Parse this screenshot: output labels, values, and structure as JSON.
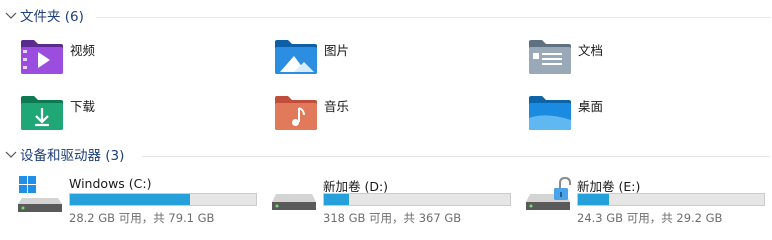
{
  "folders_section": {
    "title": "文件夹 (6)",
    "items": [
      {
        "label": "视频",
        "icon": "videos-folder-icon"
      },
      {
        "label": "图片",
        "icon": "pictures-folder-icon"
      },
      {
        "label": "文档",
        "icon": "documents-folder-icon"
      },
      {
        "label": "下载",
        "icon": "downloads-folder-icon"
      },
      {
        "label": "音乐",
        "icon": "music-folder-icon"
      },
      {
        "label": "桌面",
        "icon": "desktop-folder-icon"
      }
    ]
  },
  "drives_section": {
    "title": "设备和驱动器 (3)",
    "drives": [
      {
        "name": "Windows (C:)",
        "size_text": "28.2 GB 可用，共 79.1 GB",
        "used_fraction": 0.643,
        "icon": "windows-drive-icon"
      },
      {
        "name": "新加卷 (D:)",
        "size_text": "318 GB 可用，共 367 GB",
        "used_fraction": 0.134,
        "icon": "hard-drive-icon"
      },
      {
        "name": "新加卷 (E:)",
        "size_text": "24.3 GB 可用，共 29.2 GB",
        "used_fraction": 0.168,
        "icon": "unlocked-drive-icon"
      }
    ]
  },
  "colors": {
    "section_title": "#1f3f7a",
    "usage_bar_fill": "#26a0da",
    "usage_bar_track": "#e6e6e6",
    "secondary_text": "#6d6d6d"
  }
}
